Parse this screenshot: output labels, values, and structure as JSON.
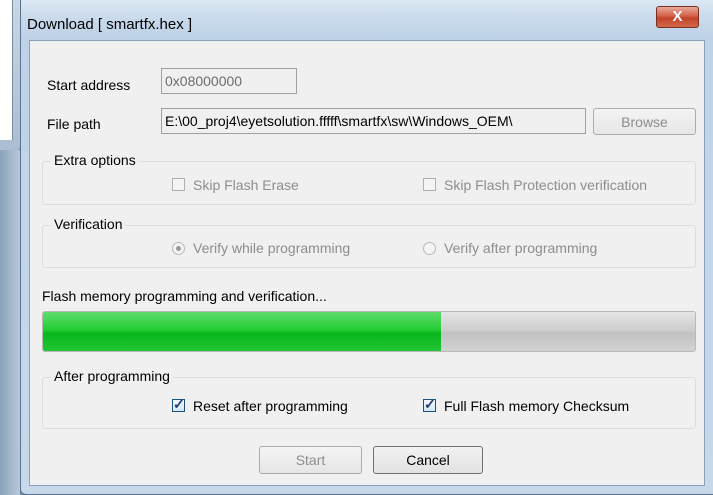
{
  "dialog": {
    "title": "Download [ smartfx.hex ]",
    "close_glyph": "X",
    "start_address_label": "Start address",
    "start_address_value": "0x08000000",
    "file_path_label": "File path",
    "file_path_value": "E:\\00_proj4\\eyetsolution.fffff\\smartfx\\sw\\Windows_OEM\\",
    "browse_label": "Browse",
    "extra_options": {
      "label": "Extra options",
      "skip_flash_erase": "Skip Flash Erase",
      "skip_flash_protection": "Skip Flash Protection verification"
    },
    "verification": {
      "label": "Verification",
      "verify_while": "Verify while programming",
      "verify_after": "Verify after programming",
      "selected": "verify_while"
    },
    "progress": {
      "label": "Flash memory programming and verification...",
      "percent": 61
    },
    "after_programming": {
      "label": "After programming",
      "reset_after": "Reset after programming",
      "reset_after_checked": true,
      "full_checksum": "Full Flash memory Checksum",
      "full_checksum_checked": true
    },
    "start_label": "Start",
    "cancel_label": "Cancel"
  },
  "colors": {
    "progress_green": "#06b71a",
    "close_red": "#c2412a"
  }
}
